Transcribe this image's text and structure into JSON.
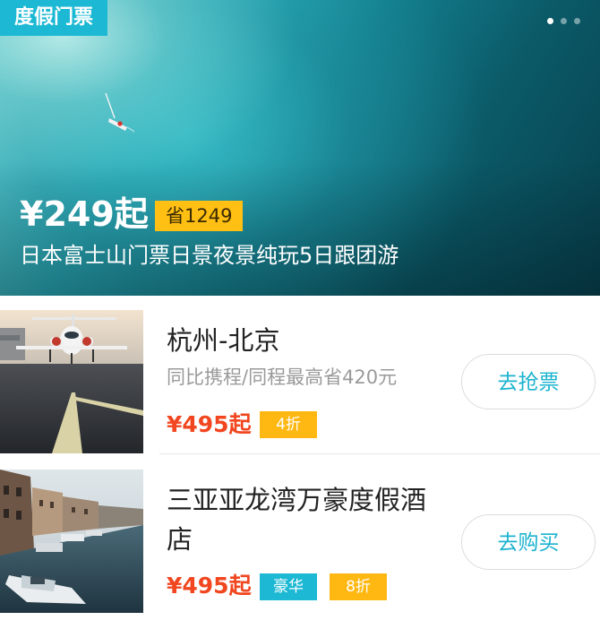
{
  "hero": {
    "tag": "度假门票",
    "price": "¥249起",
    "save": "省1249",
    "title": "日本富士山门票日景夜景纯玩5日跟团游",
    "carousel_dots": 3,
    "active_dot": 0
  },
  "items": [
    {
      "title": "杭州-北京",
      "subtitle": "同比携程/同程最高省420元",
      "price": "¥495起",
      "badges": [
        {
          "text": "4折",
          "color": "#ffb812"
        }
      ],
      "cta": "去抢票",
      "image": "private-jet-on-runway"
    },
    {
      "title_line1": "三亚亚龙湾万豪度假酒",
      "title_line2": "店",
      "price": "¥495起",
      "badges": [
        {
          "text": "豪华",
          "color": "#1cb8d4"
        },
        {
          "text": "8折",
          "color": "#ffb812"
        }
      ],
      "cta": "去购买",
      "image": "venice-canal-boats"
    }
  ],
  "colors": {
    "accent": "#1cb8d4",
    "price": "#f1461f",
    "badge_yellow": "#ffb812",
    "save_yellow": "#ffbf13"
  }
}
